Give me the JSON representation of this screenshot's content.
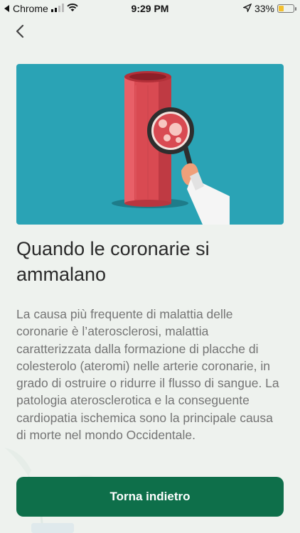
{
  "status_bar": {
    "back_app": "Chrome",
    "time": "9:29 PM",
    "battery": "33%",
    "battery_level": 0.33,
    "icons": [
      "signal-icon",
      "wifi-icon",
      "location-icon",
      "battery-icon"
    ]
  },
  "nav": {
    "back_icon": "chevron-left-icon"
  },
  "hero": {
    "illustration": "artery-magnifier-illustration",
    "background_color": "#2aa3b5"
  },
  "article": {
    "title": "Quando le coronarie si ammalano",
    "body": "La causa più frequente di malattia delle coronarie è l’aterosclerosi, malattia caratterizzata dalla formazione di placche di colesterolo (ateromi) nelle arterie coronarie, in grado di ostruire o ridurre il flusso di sangue. La patologia aterosclerotica e la conseguente cardiopatia ischemica sono la principale causa di morte nel mondo Occidentale."
  },
  "actions": {
    "back_label": "Torna indietro",
    "button_color": "#0e6f4a"
  }
}
